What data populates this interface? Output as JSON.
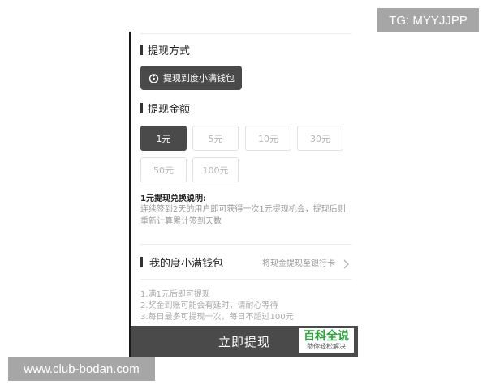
{
  "withdraw_method": {
    "title": "提现方式",
    "option_label": "提现到度小满钱包",
    "option_icon": "wallet-icon"
  },
  "withdraw_amount": {
    "title": "提现金额",
    "options": [
      "1元",
      "5元",
      "10元",
      "30元",
      "50元",
      "100元"
    ],
    "selected": "1元"
  },
  "note": {
    "title": "1元提现兑换说明:",
    "body": "连续签到2天的用户即可获得一次1元提现机会，提现后则重新计算累计签到天数"
  },
  "wallet": {
    "title": "我的度小满钱包",
    "hint": "将现金提现至银行卡",
    "chevron_icon": "chevron-right-icon"
  },
  "rules": [
    "1.满1元后即可提现",
    "2.奖金到账可能会有延时，请耐心等待",
    "3.每日最多可提现一次，每日不超过100元"
  ],
  "submit_label": "立即提现",
  "logo": {
    "main": "百科全说",
    "sub": "助你轻松解决"
  },
  "watermarks": {
    "tg": "TG: MYYJJPP",
    "site": "www.club-bodan.com"
  },
  "colors": {
    "dark_button": "#4a4a4a",
    "logo_green": "#2aa43b"
  }
}
